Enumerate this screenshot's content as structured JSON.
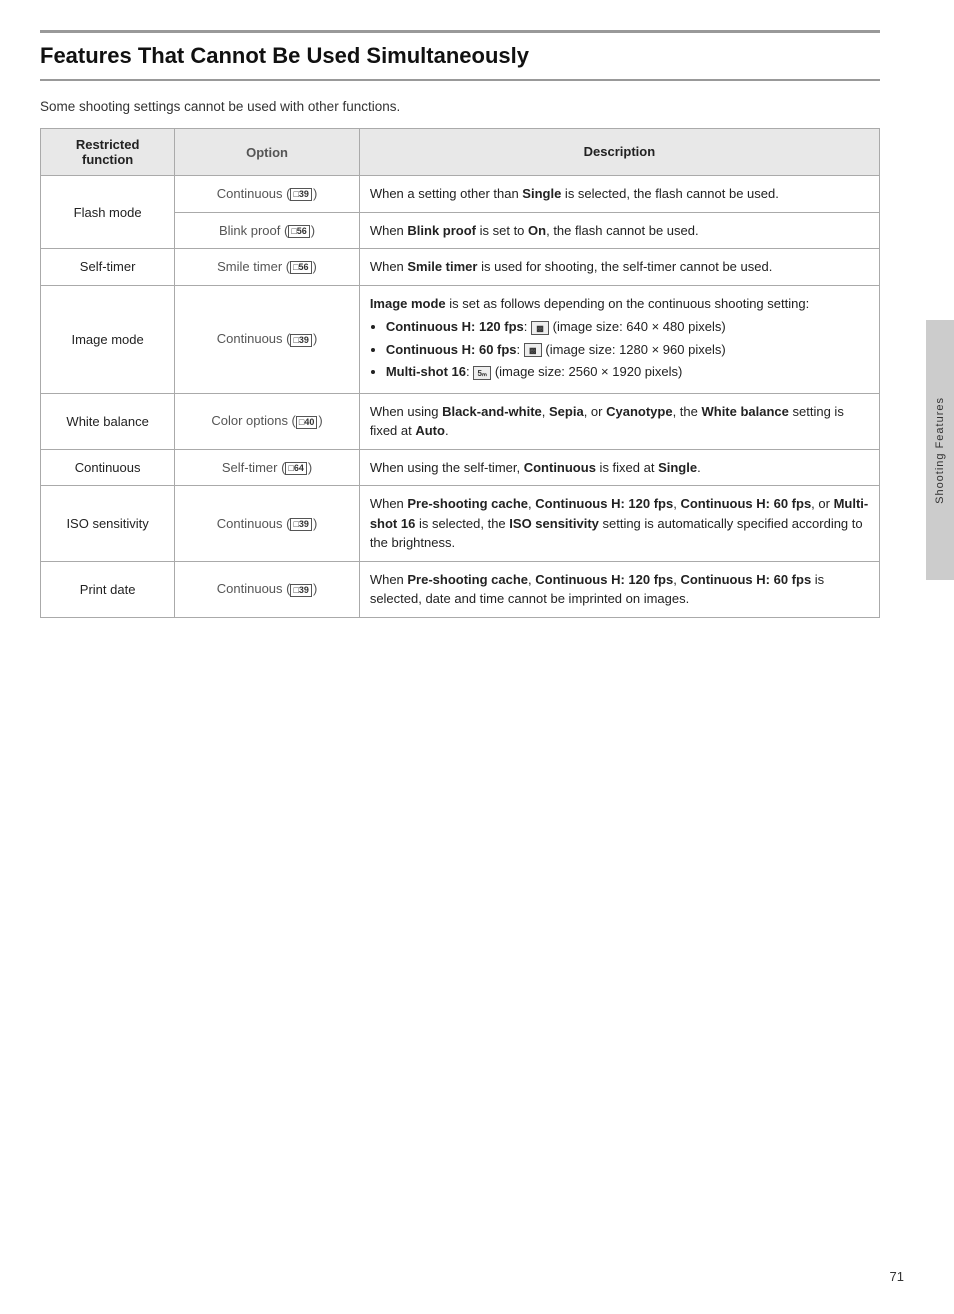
{
  "page": {
    "title": "Features That Cannot Be Used Simultaneously",
    "subtitle": "Some shooting settings cannot be used with other functions.",
    "side_tab": "Shooting Features",
    "page_number": "71"
  },
  "table": {
    "headers": {
      "restricted": "Restricted function",
      "option": "Option",
      "description": "Description"
    },
    "rows": [
      {
        "restricted": "Flash mode",
        "options": [
          {
            "option": "Continuous (",
            "ref": "39",
            "close": ")"
          },
          {
            "option": "Blink proof (",
            "ref": "56",
            "close": ")"
          }
        ],
        "descriptions": [
          "When a setting other than <b>Single</b> is selected, the flash cannot be used.",
          "When <b>Blink proof</b> is set to <b>On</b>, the flash cannot be used."
        ]
      },
      {
        "restricted": "Self-timer",
        "options": [
          {
            "option": "Smile timer (",
            "ref": "56",
            "close": ")"
          }
        ],
        "descriptions": [
          "When <b>Smile timer</b> is used for shooting, the self-timer cannot be used."
        ]
      },
      {
        "restricted": "Image mode",
        "options": [
          {
            "option": "Continuous (",
            "ref": "39",
            "close": ")"
          }
        ],
        "descriptions": [
          "image_mode_complex"
        ]
      },
      {
        "restricted": "White balance",
        "options": [
          {
            "option": "Color options (",
            "ref": "40",
            "close": ")"
          }
        ],
        "descriptions": [
          "When using <b>Black-and-white</b>, <b>Sepia</b>, or <b>Cyanotype</b>, the <b>White balance</b> setting is fixed at <b>Auto</b>."
        ]
      },
      {
        "restricted": "Continuous",
        "options": [
          {
            "option": "Self-timer (",
            "ref": "64",
            "close": ")"
          }
        ],
        "descriptions": [
          "When using the self-timer, <b>Continuous</b> is fixed at <b>Single</b>."
        ]
      },
      {
        "restricted": "ISO sensitivity",
        "options": [
          {
            "option": "Continuous (",
            "ref": "39",
            "close": ")"
          }
        ],
        "descriptions": [
          "When <b>Pre-shooting cache</b>, <b>Continuous H: 120 fps</b>, <b>Continuous H: 60 fps</b>, or <b>Multi-shot 16</b> is selected, the <b>ISO sensitivity</b> setting is automatically specified according to the brightness."
        ]
      },
      {
        "restricted": "Print date",
        "options": [
          {
            "option": "Continuous (",
            "ref": "39",
            "close": ")"
          }
        ],
        "descriptions": [
          "When <b>Pre-shooting cache</b>, <b>Continuous H: 120 fps</b>, <b>Continuous H: 60 fps</b> is selected, date and time cannot be imprinted on images."
        ]
      }
    ]
  }
}
